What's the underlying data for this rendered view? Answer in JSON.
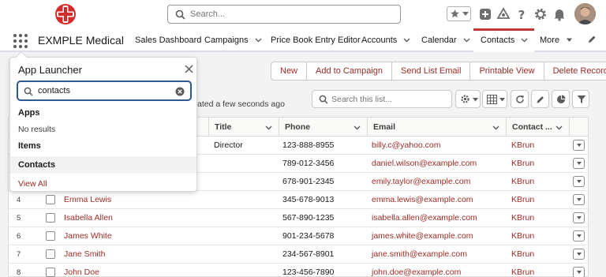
{
  "header": {
    "search_placeholder": "Search..."
  },
  "nav": {
    "app_name": "EXMPLE Medical",
    "items": [
      {
        "label": "Sales Dashboard",
        "has_menu": false
      },
      {
        "label": "Campaigns",
        "has_menu": true
      },
      {
        "label": "Price Book Entry Editor",
        "has_menu": false
      },
      {
        "label": "Accounts",
        "has_menu": true
      },
      {
        "label": "Calendar",
        "has_menu": true
      },
      {
        "label": "Contacts",
        "has_menu": true,
        "active": true
      },
      {
        "label": "More",
        "has_menu": true
      }
    ]
  },
  "actions": {
    "new": "New",
    "add_to_campaign": "Add to Campaign",
    "send_list_email": "Send List Email",
    "printable_view": "Printable View",
    "delete_record": "Delete Record"
  },
  "list": {
    "updated_text": "ated a few seconds ago",
    "search_placeholder": "Search this list...",
    "columns": {
      "title": "Title",
      "phone": "Phone",
      "email": "Email",
      "owner": "Contact ..."
    },
    "rows": [
      {
        "num": "",
        "name": "",
        "title": "Director",
        "phone": "123-888-8955",
        "email": "billy.c@yahoo.com",
        "owner": "KBrun"
      },
      {
        "num": "",
        "name": "",
        "title": "",
        "phone": "789-012-3456",
        "email": "daniel.wilson@example.com",
        "owner": "KBrun"
      },
      {
        "num": "",
        "name": "",
        "title": "",
        "phone": "678-901-2345",
        "email": "emily.taylor@example.com",
        "owner": "KBrun"
      },
      {
        "num": "4",
        "name": "Emma Lewis",
        "title": "",
        "phone": "345-678-9013",
        "email": "emma.lewis@example.com",
        "owner": "KBrun"
      },
      {
        "num": "5",
        "name": "Isabella Allen",
        "title": "",
        "phone": "567-890-1235",
        "email": "isabella.allen@example.com",
        "owner": "KBrun"
      },
      {
        "num": "6",
        "name": "James White",
        "title": "",
        "phone": "901-234-5678",
        "email": "james.white@example.com",
        "owner": "KBrun"
      },
      {
        "num": "7",
        "name": "Jane Smith",
        "title": "",
        "phone": "234-567-8901",
        "email": "jane.smith@example.com",
        "owner": "KBrun"
      },
      {
        "num": "8",
        "name": "John Doe",
        "title": "",
        "phone": "123-456-7890",
        "email": "john.doe@example.com",
        "owner": "KBrun"
      }
    ]
  },
  "launcher": {
    "title": "App Launcher",
    "search_value": "contacts",
    "apps_heading": "Apps",
    "no_results": "No results",
    "items_heading": "Items",
    "contacts_item": "Contacts",
    "view_all": "View All"
  },
  "colors": {
    "accent": "#9c2b25",
    "active_tab": "#c23934",
    "logo_red": "#d62b2b"
  }
}
